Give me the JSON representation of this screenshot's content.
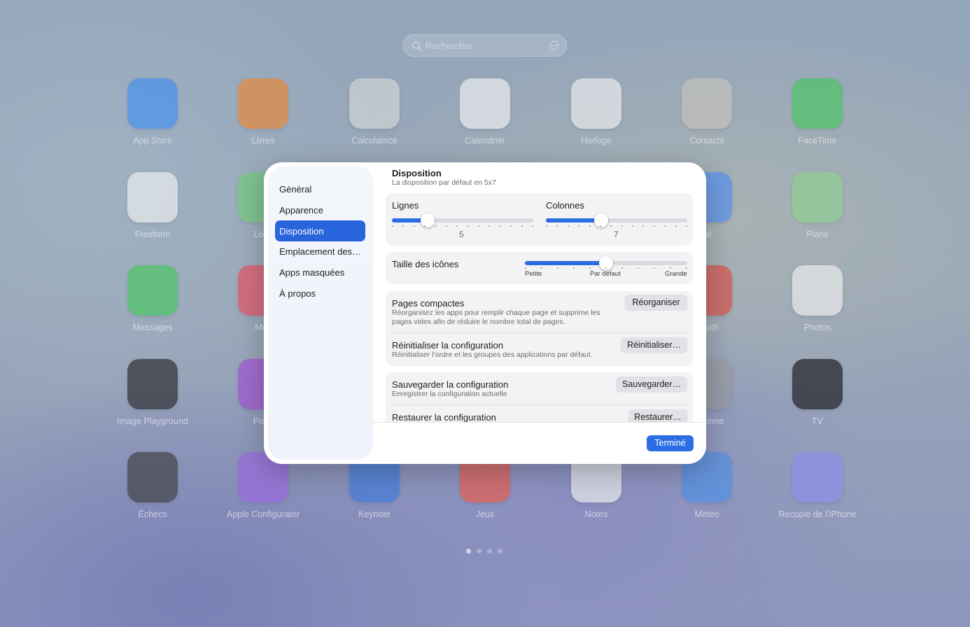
{
  "search": {
    "placeholder": "Rechercher"
  },
  "apps": [
    {
      "label": "App Store",
      "icon": "app-store-icon",
      "color": "#3f8ef3"
    },
    {
      "label": "Livres",
      "icon": "books-icon",
      "color": "#f0852a"
    },
    {
      "label": "Calculatrice",
      "icon": "calculator-icon",
      "color": "#d9d9d9"
    },
    {
      "label": "Calendrier",
      "icon": "calendar-icon",
      "color": "#f6f6f6"
    },
    {
      "label": "Horloge",
      "icon": "clock-icon",
      "color": "#f2f2f2"
    },
    {
      "label": "Contacts",
      "icon": "contacts-icon",
      "color": "#c9c4bd"
    },
    {
      "label": "FaceTime",
      "icon": "facetime-icon",
      "color": "#42c95a"
    },
    {
      "label": "Freeform",
      "icon": "freeform-icon",
      "color": "#f4f4f4"
    },
    {
      "label": "Loca",
      "icon": "find-my-icon",
      "color": "#6fcf74"
    },
    {
      "label": "ail",
      "icon": "mail-icon",
      "color": "#4c8ef6"
    },
    {
      "label": "Plans",
      "icon": "maps-icon",
      "color": "#8fd28e"
    },
    {
      "label": "Messages",
      "icon": "messages-icon",
      "color": "#41c85a"
    },
    {
      "label": "Mus",
      "icon": "music-icon",
      "color": "#f24a5e"
    },
    {
      "label": "Booth",
      "icon": "photo-booth-icon",
      "color": "#e0493d"
    },
    {
      "label": "Photos",
      "icon": "photos-icon",
      "color": "#f4f4f4"
    },
    {
      "label": "Image Playground",
      "icon": "image-playground-icon",
      "color": "#222"
    },
    {
      "label": "Podc",
      "icon": "podcasts-icon",
      "color": "#a24bd8"
    },
    {
      "label": "Système",
      "icon": "system-settings-icon",
      "color": "#9a9a9e"
    },
    {
      "label": "TV",
      "icon": "tv-icon",
      "color": "#111"
    },
    {
      "label": "Échecs",
      "icon": "chess-icon",
      "color": "#3a3a3a"
    },
    {
      "label": "Apple Configurator",
      "icon": "apple-configurator-icon",
      "color": "#9d65e4"
    },
    {
      "label": "Keynote",
      "icon": "keynote-icon",
      "color": "#3b7be0"
    },
    {
      "label": "Jeux",
      "icon": "games-icon",
      "color": "#f25a44"
    },
    {
      "label": "Notes",
      "icon": "notes-icon",
      "color": "#f7f7f2"
    },
    {
      "label": "Météo",
      "icon": "weather-icon",
      "color": "#4a8fe8"
    },
    {
      "label": "Recopie de l’iPhone",
      "icon": "iphone-mirroring-icon",
      "color": "#8f8df0"
    }
  ],
  "dialog": {
    "sidebar": [
      {
        "label": "Général",
        "active": false
      },
      {
        "label": "Apparence",
        "active": false
      },
      {
        "label": "Disposition",
        "active": true
      },
      {
        "label": "Emplacement des…",
        "active": false
      },
      {
        "label": "Apps masquées",
        "active": false
      },
      {
        "label": "À propos",
        "active": false
      }
    ],
    "section": {
      "title": "Disposition",
      "subtitle": "La disposition par défaut en 5x7"
    },
    "rows": {
      "label": "Lignes",
      "value": "5",
      "fraction": 0.25
    },
    "columns": {
      "label": "Colonnes",
      "value": "7",
      "fraction": 0.39
    },
    "icon_size": {
      "label": "Taille des icônes",
      "fraction": 0.5,
      "min": "Petite",
      "mid": "Par défaut",
      "max": "Grande"
    },
    "compact": {
      "title": "Pages compactes",
      "desc": "Réorganisez les apps pour remplir chaque page et supprime les pages vides afin de réduire le nombre total de pages.",
      "button": "Réorganiser"
    },
    "reset": {
      "title": "Réinitialiser la configuration",
      "desc": "Réinitialiser l’ordre et les groupes des applications par défaut.",
      "button": "Réinitialiser…"
    },
    "save": {
      "title": "Sauvegarder la configuration",
      "desc": "Enregistrer la configuration actuelle",
      "button": "Sauvegarder…"
    },
    "restore": {
      "title": "Restaurer la configuration",
      "button": "Restaurer…"
    },
    "done": "Terminé"
  },
  "pages": {
    "count": 4,
    "current": 1
  }
}
